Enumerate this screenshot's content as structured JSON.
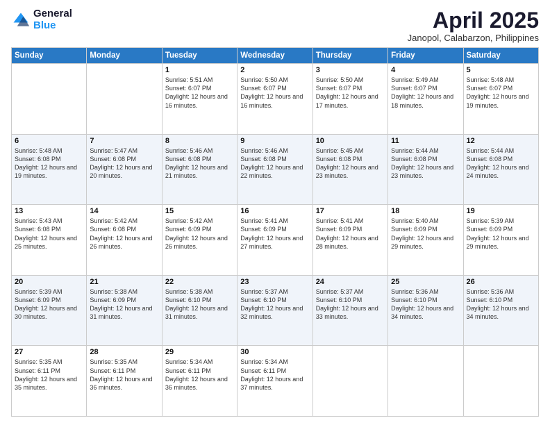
{
  "logo": {
    "general": "General",
    "blue": "Blue"
  },
  "title": "April 2025",
  "location": "Janopol, Calabarzon, Philippines",
  "days_of_week": [
    "Sunday",
    "Monday",
    "Tuesday",
    "Wednesday",
    "Thursday",
    "Friday",
    "Saturday"
  ],
  "weeks": [
    [
      {
        "num": "",
        "info": ""
      },
      {
        "num": "",
        "info": ""
      },
      {
        "num": "1",
        "info": "Sunrise: 5:51 AM\nSunset: 6:07 PM\nDaylight: 12 hours and 16 minutes."
      },
      {
        "num": "2",
        "info": "Sunrise: 5:50 AM\nSunset: 6:07 PM\nDaylight: 12 hours and 16 minutes."
      },
      {
        "num": "3",
        "info": "Sunrise: 5:50 AM\nSunset: 6:07 PM\nDaylight: 12 hours and 17 minutes."
      },
      {
        "num": "4",
        "info": "Sunrise: 5:49 AM\nSunset: 6:07 PM\nDaylight: 12 hours and 18 minutes."
      },
      {
        "num": "5",
        "info": "Sunrise: 5:48 AM\nSunset: 6:07 PM\nDaylight: 12 hours and 19 minutes."
      }
    ],
    [
      {
        "num": "6",
        "info": "Sunrise: 5:48 AM\nSunset: 6:08 PM\nDaylight: 12 hours and 19 minutes."
      },
      {
        "num": "7",
        "info": "Sunrise: 5:47 AM\nSunset: 6:08 PM\nDaylight: 12 hours and 20 minutes."
      },
      {
        "num": "8",
        "info": "Sunrise: 5:46 AM\nSunset: 6:08 PM\nDaylight: 12 hours and 21 minutes."
      },
      {
        "num": "9",
        "info": "Sunrise: 5:46 AM\nSunset: 6:08 PM\nDaylight: 12 hours and 22 minutes."
      },
      {
        "num": "10",
        "info": "Sunrise: 5:45 AM\nSunset: 6:08 PM\nDaylight: 12 hours and 23 minutes."
      },
      {
        "num": "11",
        "info": "Sunrise: 5:44 AM\nSunset: 6:08 PM\nDaylight: 12 hours and 23 minutes."
      },
      {
        "num": "12",
        "info": "Sunrise: 5:44 AM\nSunset: 6:08 PM\nDaylight: 12 hours and 24 minutes."
      }
    ],
    [
      {
        "num": "13",
        "info": "Sunrise: 5:43 AM\nSunset: 6:08 PM\nDaylight: 12 hours and 25 minutes."
      },
      {
        "num": "14",
        "info": "Sunrise: 5:42 AM\nSunset: 6:08 PM\nDaylight: 12 hours and 26 minutes."
      },
      {
        "num": "15",
        "info": "Sunrise: 5:42 AM\nSunset: 6:09 PM\nDaylight: 12 hours and 26 minutes."
      },
      {
        "num": "16",
        "info": "Sunrise: 5:41 AM\nSunset: 6:09 PM\nDaylight: 12 hours and 27 minutes."
      },
      {
        "num": "17",
        "info": "Sunrise: 5:41 AM\nSunset: 6:09 PM\nDaylight: 12 hours and 28 minutes."
      },
      {
        "num": "18",
        "info": "Sunrise: 5:40 AM\nSunset: 6:09 PM\nDaylight: 12 hours and 29 minutes."
      },
      {
        "num": "19",
        "info": "Sunrise: 5:39 AM\nSunset: 6:09 PM\nDaylight: 12 hours and 29 minutes."
      }
    ],
    [
      {
        "num": "20",
        "info": "Sunrise: 5:39 AM\nSunset: 6:09 PM\nDaylight: 12 hours and 30 minutes."
      },
      {
        "num": "21",
        "info": "Sunrise: 5:38 AM\nSunset: 6:09 PM\nDaylight: 12 hours and 31 minutes."
      },
      {
        "num": "22",
        "info": "Sunrise: 5:38 AM\nSunset: 6:10 PM\nDaylight: 12 hours and 31 minutes."
      },
      {
        "num": "23",
        "info": "Sunrise: 5:37 AM\nSunset: 6:10 PM\nDaylight: 12 hours and 32 minutes."
      },
      {
        "num": "24",
        "info": "Sunrise: 5:37 AM\nSunset: 6:10 PM\nDaylight: 12 hours and 33 minutes."
      },
      {
        "num": "25",
        "info": "Sunrise: 5:36 AM\nSunset: 6:10 PM\nDaylight: 12 hours and 34 minutes."
      },
      {
        "num": "26",
        "info": "Sunrise: 5:36 AM\nSunset: 6:10 PM\nDaylight: 12 hours and 34 minutes."
      }
    ],
    [
      {
        "num": "27",
        "info": "Sunrise: 5:35 AM\nSunset: 6:11 PM\nDaylight: 12 hours and 35 minutes."
      },
      {
        "num": "28",
        "info": "Sunrise: 5:35 AM\nSunset: 6:11 PM\nDaylight: 12 hours and 36 minutes."
      },
      {
        "num": "29",
        "info": "Sunrise: 5:34 AM\nSunset: 6:11 PM\nDaylight: 12 hours and 36 minutes."
      },
      {
        "num": "30",
        "info": "Sunrise: 5:34 AM\nSunset: 6:11 PM\nDaylight: 12 hours and 37 minutes."
      },
      {
        "num": "",
        "info": ""
      },
      {
        "num": "",
        "info": ""
      },
      {
        "num": "",
        "info": ""
      }
    ]
  ]
}
